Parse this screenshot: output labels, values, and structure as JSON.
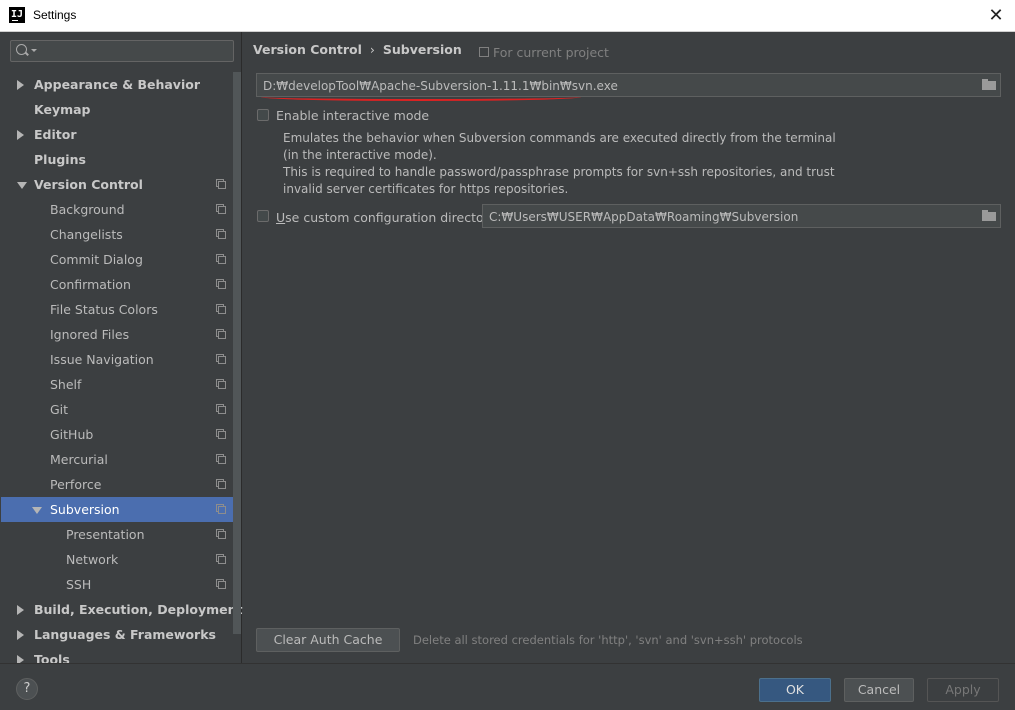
{
  "window": {
    "title": "Settings",
    "app_icon_glyph": "IJ",
    "close_glyph": "✕"
  },
  "sidebar": {
    "search_placeholder": "",
    "items": [
      {
        "label": "Appearance & Behavior",
        "bold": true,
        "arrow": "right",
        "indent": 0,
        "copy": false
      },
      {
        "label": "Keymap",
        "bold": true,
        "arrow": "none",
        "indent": 0,
        "copy": false
      },
      {
        "label": "Editor",
        "bold": true,
        "arrow": "right",
        "indent": 0,
        "copy": false
      },
      {
        "label": "Plugins",
        "bold": true,
        "arrow": "none",
        "indent": 0,
        "copy": false
      },
      {
        "label": "Version Control",
        "bold": true,
        "arrow": "down",
        "indent": 0,
        "copy": true
      },
      {
        "label": "Background",
        "bold": false,
        "arrow": "none",
        "indent": 1,
        "copy": true
      },
      {
        "label": "Changelists",
        "bold": false,
        "arrow": "none",
        "indent": 1,
        "copy": true
      },
      {
        "label": "Commit Dialog",
        "bold": false,
        "arrow": "none",
        "indent": 1,
        "copy": true
      },
      {
        "label": "Confirmation",
        "bold": false,
        "arrow": "none",
        "indent": 1,
        "copy": true
      },
      {
        "label": "File Status Colors",
        "bold": false,
        "arrow": "none",
        "indent": 1,
        "copy": true
      },
      {
        "label": "Ignored Files",
        "bold": false,
        "arrow": "none",
        "indent": 1,
        "copy": true
      },
      {
        "label": "Issue Navigation",
        "bold": false,
        "arrow": "none",
        "indent": 1,
        "copy": true
      },
      {
        "label": "Shelf",
        "bold": false,
        "arrow": "none",
        "indent": 1,
        "copy": true
      },
      {
        "label": "Git",
        "bold": false,
        "arrow": "none",
        "indent": 1,
        "copy": true
      },
      {
        "label": "GitHub",
        "bold": false,
        "arrow": "none",
        "indent": 1,
        "copy": true
      },
      {
        "label": "Mercurial",
        "bold": false,
        "arrow": "none",
        "indent": 1,
        "copy": true
      },
      {
        "label": "Perforce",
        "bold": false,
        "arrow": "none",
        "indent": 1,
        "copy": true
      },
      {
        "label": "Subversion",
        "bold": false,
        "arrow": "down",
        "indent": 1,
        "copy": true,
        "selected": true
      },
      {
        "label": "Presentation",
        "bold": false,
        "arrow": "none",
        "indent": 2,
        "copy": true
      },
      {
        "label": "Network",
        "bold": false,
        "arrow": "none",
        "indent": 2,
        "copy": true
      },
      {
        "label": "SSH",
        "bold": false,
        "arrow": "none",
        "indent": 2,
        "copy": true
      },
      {
        "label": "Build, Execution, Deployment",
        "bold": true,
        "arrow": "right",
        "indent": 0,
        "copy": false
      },
      {
        "label": "Languages & Frameworks",
        "bold": true,
        "arrow": "right",
        "indent": 0,
        "copy": false
      },
      {
        "label": "Tools",
        "bold": true,
        "arrow": "right",
        "indent": 0,
        "copy": false
      }
    ]
  },
  "content": {
    "breadcrumb": {
      "parent": "Version Control",
      "separator": "›",
      "current": "Subversion"
    },
    "scope_label": "For current project",
    "svn_path": "D:₩developTool₩Apache-Subversion-1.11.1₩bin₩svn.exe",
    "interactive_mode": {
      "label": "Enable interactive mode",
      "checked": false,
      "description": [
        "Emulates the behavior when Subversion commands are executed directly from the terminal",
        "(in the interactive mode).",
        "This is required to handle password/passphrase prompts for svn+ssh repositories, and trust",
        "invalid server certificates for https repositories."
      ]
    },
    "custom_config": {
      "label_prefix": "U",
      "label_rest": "se custom configuration directory:",
      "checked": false,
      "path": "C:₩Users₩USER₩AppData₩Roaming₩Subversion"
    },
    "clear_auth_cache_label": "Clear Auth Cache",
    "clear_auth_cache_desc": "Delete all stored credentials for 'http', 'svn' and 'svn+ssh' protocols"
  },
  "footer": {
    "help_glyph": "?",
    "ok_label": "OK",
    "cancel_label": "Cancel",
    "apply_label": "Apply"
  },
  "colors": {
    "background": "#3c3f41",
    "selection": "#4b6eaf",
    "primary_button": "#365880",
    "annotation_red": "#d22222"
  }
}
